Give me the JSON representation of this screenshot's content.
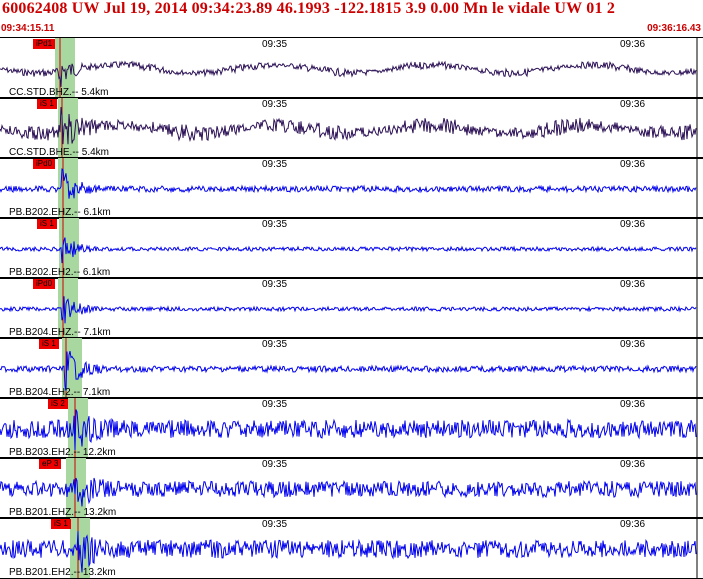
{
  "header": {
    "title": "60062408 UW Jul 19, 2014 09:34:23.89    46.1993 -122.1815  3.9 0.00 Mn le vidale UW 01   2",
    "start_time": "09:34:15.11",
    "end_time": "09:36:16.43"
  },
  "colors": {
    "header_text": "#cc0000",
    "pick_flag": "#ee0000",
    "band": "#a8d8a0",
    "trace_dark": "#2b1055",
    "trace_blue": "#0000ee"
  },
  "time_ticks": [
    "09:35",
    "09:36"
  ],
  "traces": [
    {
      "label": "CC.STD.BHZ.-- 5.4km",
      "pick": "iPd1"
    },
    {
      "label": "CC.STD.BHE.-- 5.4km",
      "pick": "iS 1"
    },
    {
      "label": "PB.B202.EHZ.-- 6.1km",
      "pick": "iPd0"
    },
    {
      "label": "PB.B202.EH2.-- 6.1km",
      "pick": "iS 1"
    },
    {
      "label": "PB.B204.EHZ.-- 7.1km",
      "pick": "iPd0"
    },
    {
      "label": "PB.B204.EH2.-- 7.1km",
      "pick": "iS 1"
    },
    {
      "label": "PB.B203.EH2.-- 12.2km",
      "pick": "iS 2"
    },
    {
      "label": "PB.B201.EHZ.-- 13.2km",
      "pick": "eP 3"
    },
    {
      "label": "PB.B201.EH2.-- 13.2km",
      "pick": "iS 1"
    }
  ]
}
